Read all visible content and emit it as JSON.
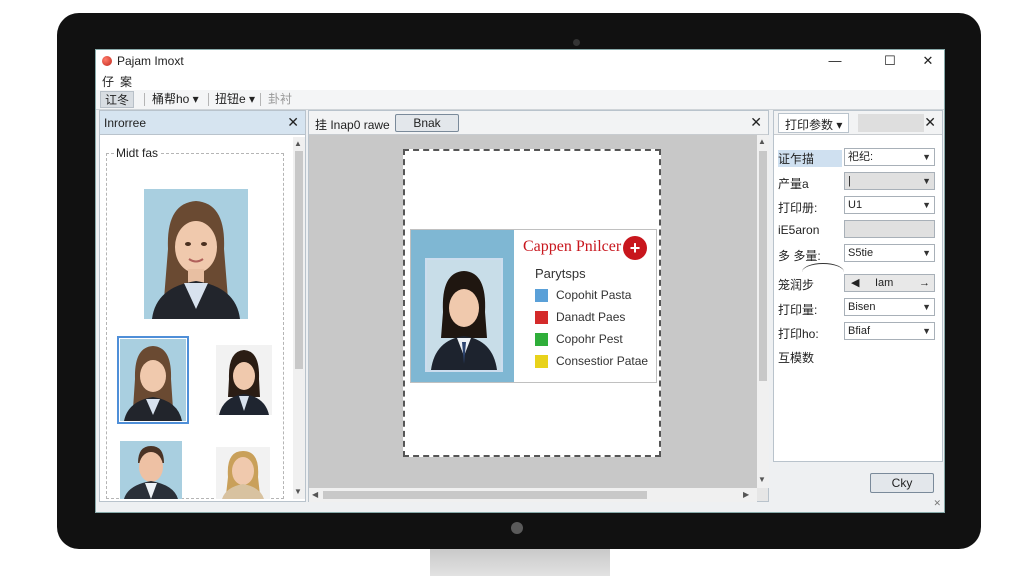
{
  "window": {
    "title": "Pajam Imoxt",
    "min": "—",
    "max": "☐",
    "close": "✕"
  },
  "menu": [
    "仔",
    "案"
  ],
  "toolbar": [
    "讧冬",
    "桶帮ho ▾",
    "扭钮e ▾",
    "卦衬"
  ],
  "left_panel": {
    "title": "Inrorree",
    "close": "✕",
    "group_label": "Midt fas"
  },
  "center_panel": {
    "label": "挂  Inap0 rawe",
    "button": "Bnak",
    "close": "✕"
  },
  "card": {
    "title": "Cappen Pnilcer",
    "plus": "+",
    "subtitle": "Parytsps",
    "rows": [
      {
        "text": "Copohit Pasta",
        "color": "#5aa0d8"
      },
      {
        "text": "Danadt Paes",
        "color": "#d42a2a"
      },
      {
        "text": "Copohr Pest",
        "color": "#2fae3a"
      },
      {
        "text": "Consestior Patae",
        "color": "#e8d21a"
      }
    ]
  },
  "right_panel": {
    "tab": "打印参数",
    "tab_arrow": "▾",
    "close": "✕",
    "props": [
      {
        "label": "证乍描",
        "value": "祀纪:",
        "type": "dropdown"
      },
      {
        "label": "产量a",
        "value": "|",
        "type": "dropdown-grey"
      },
      {
        "label": "打印册:",
        "value": "U1",
        "type": "dropdown"
      },
      {
        "label": "iE5aron",
        "value": "",
        "type": "blank-grey"
      },
      {
        "label": "多 多量:",
        "value": "S5tie",
        "type": "dropdown"
      },
      {
        "label": "笼润步",
        "value": "Iam",
        "type": "stepper"
      },
      {
        "label": "打印量:",
        "value": "Bisen",
        "type": "dropdown"
      },
      {
        "label": "打印ho:",
        "value": "Bfiaf",
        "type": "dropdown"
      },
      {
        "label": "互模数",
        "value": "",
        "type": "none"
      }
    ],
    "ok_button": "Cky"
  },
  "colors": {
    "accent": "#4f8fd8",
    "brand_red": "#c8161d",
    "header_blue": "#d6e4f0"
  }
}
